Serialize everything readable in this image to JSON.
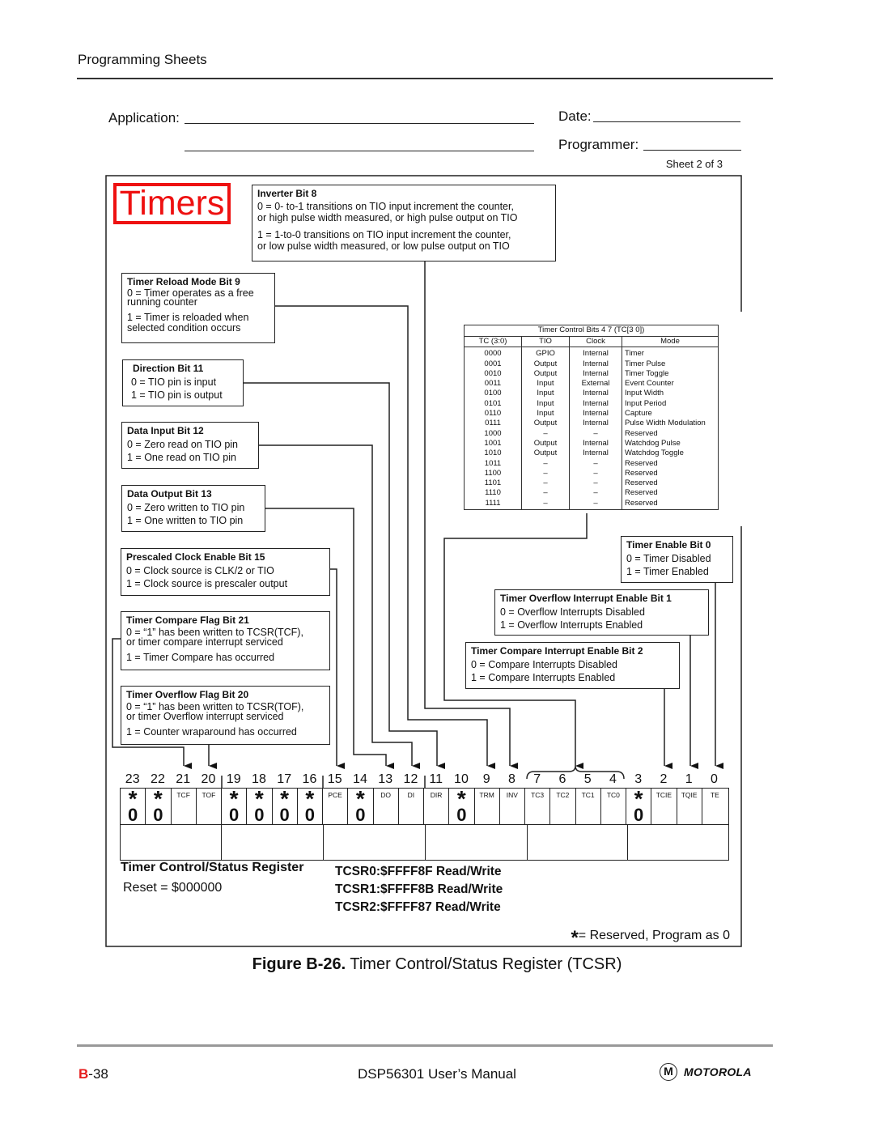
{
  "header": {
    "section": "Programming Sheets"
  },
  "form": {
    "application_label": "Application:",
    "application_value": "",
    "application_value_line2": "",
    "date_label": "Date:",
    "date_value": "",
    "programmer_label": "Programmer:",
    "programmer_value": "",
    "sheet": "Sheet 2 of 3"
  },
  "diagram": {
    "badge": "Timers",
    "boxes": {
      "inverter": {
        "title": "Inverter Bit 8",
        "lines": [
          "0  = 0- to-1 transitions on TIO input increment the counter,",
          "or high pulse width measured, or high pulse output on TIO",
          "1 = 1-to-0 transitions on TIO input increment the counter,",
          "or low pulse width measured, or low pulse output on TIO"
        ]
      },
      "reload": {
        "title": "Timer Reload Mode Bit 9",
        "lines": [
          "0 = Timer operates as a free",
          "running counter",
          "1 = Timer is reloaded when",
          "selected condition occurs"
        ]
      },
      "direction": {
        "title": "Direction Bit 11",
        "lines": [
          "0 = TIO pin is input",
          "1 = TIO pin is output"
        ]
      },
      "data_input": {
        "title": "Data Input Bit 12",
        "lines": [
          "0 = Zero read on TIO pin",
          "1 = One read on TIO pin"
        ]
      },
      "data_output": {
        "title": "Data Output Bit 13",
        "lines": [
          "0 = Zero written to TIO pin",
          "1 = One written to TIO pin"
        ]
      },
      "prescaled": {
        "title": "Prescaled Clock Enable Bit 15",
        "lines": [
          "0 = Clock source is CLK/2 or TIO",
          "1 = Clock source is prescaler output"
        ]
      },
      "compare_flag": {
        "title": "Timer Compare Flag Bit 21",
        "lines": [
          "0 = “1” has been written to TCSR(TCF),",
          "or timer compare interrupt serviced",
          "1 = Timer Compare has occurred"
        ]
      },
      "overflow_flag": {
        "title": "Timer Overflow Flag Bit 20",
        "lines": [
          "0 = “1” has been written to TCSR(TOF),",
          "or timer Overflow interrupt serviced",
          "1 = Counter wraparound has occurred"
        ]
      },
      "enable": {
        "title": "Timer Enable Bit 0",
        "lines": [
          "0 = Timer Disabled",
          "1 = Timer Enabled"
        ]
      },
      "overflow_irq": {
        "title": "Timer Overflow Interrupt Enable Bit 1",
        "lines": [
          "0 = Overflow Interrupts Disabled",
          "1 = Overflow Interrupts Enabled"
        ]
      },
      "compare_irq": {
        "title": "Timer Compare Interrupt Enable Bit 2",
        "lines": [
          "0 = Compare Interrupts Disabled",
          "1 = Compare Interrupts Enabled"
        ]
      }
    },
    "tc_table": {
      "caption": "Timer Control Bits 4 7 (TC[3 0])",
      "headers": [
        "TC (3:0)",
        "TIO",
        "Clock",
        "Mode"
      ],
      "rows": [
        [
          "0000",
          "GPIO",
          "Internal",
          "Timer"
        ],
        [
          "0001",
          "Output",
          "Internal",
          "Timer Pulse"
        ],
        [
          "0010",
          "Output",
          "Internal",
          "Timer Toggle"
        ],
        [
          "0011",
          "Input",
          "External",
          "Event Counter"
        ],
        [
          "0100",
          "Input",
          "Internal",
          "Input Width"
        ],
        [
          "0101",
          "Input",
          "Internal",
          "Input Period"
        ],
        [
          "0110",
          "Input",
          "Internal",
          "Capture"
        ],
        [
          "0111",
          "Output",
          "Internal",
          "Pulse Width Modulation"
        ],
        [
          "1000",
          "–",
          "–",
          "Reserved"
        ],
        [
          "1001",
          "Output",
          "Internal",
          "Watchdog Pulse"
        ],
        [
          "1010",
          "Output",
          "Internal",
          "Watchdog Toggle"
        ],
        [
          "1011",
          "–",
          "–",
          "Reserved"
        ],
        [
          "1100",
          "–",
          "–",
          "Reserved"
        ],
        [
          "1101",
          "–",
          "–",
          "Reserved"
        ],
        [
          "1110",
          "–",
          "–",
          "Reserved"
        ],
        [
          "1111",
          "–",
          "–",
          "Reserved"
        ]
      ]
    },
    "register": {
      "bits": [
        {
          "n": "23",
          "name": "",
          "reserved": true
        },
        {
          "n": "22",
          "name": "",
          "reserved": true
        },
        {
          "n": "21",
          "name": "TCF",
          "reserved": false
        },
        {
          "n": "20",
          "name": "TOF",
          "reserved": false
        },
        {
          "n": "19",
          "name": "",
          "reserved": true
        },
        {
          "n": "18",
          "name": "",
          "reserved": true
        },
        {
          "n": "17",
          "name": "",
          "reserved": true
        },
        {
          "n": "16",
          "name": "",
          "reserved": true
        },
        {
          "n": "15",
          "name": "PCE",
          "reserved": false
        },
        {
          "n": "14",
          "name": "",
          "reserved": true
        },
        {
          "n": "13",
          "name": "DO",
          "reserved": false
        },
        {
          "n": "12",
          "name": "DI",
          "reserved": false
        },
        {
          "n": "11",
          "name": "DIR",
          "reserved": false
        },
        {
          "n": "10",
          "name": "",
          "reserved": true
        },
        {
          "n": "9",
          "name": "TRM",
          "reserved": false
        },
        {
          "n": "8",
          "name": "INV",
          "reserved": false
        },
        {
          "n": "7",
          "name": "TC3",
          "reserved": false
        },
        {
          "n": "6",
          "name": "TC2",
          "reserved": false
        },
        {
          "n": "5",
          "name": "TC1",
          "reserved": false
        },
        {
          "n": "4",
          "name": "TC0",
          "reserved": false
        },
        {
          "n": "3",
          "name": "",
          "reserved": true
        },
        {
          "n": "2",
          "name": "TCIE",
          "reserved": false
        },
        {
          "n": "1",
          "name": "TQIE",
          "reserved": false
        },
        {
          "n": "0",
          "name": "TE",
          "reserved": false
        }
      ],
      "reserved_star": "*",
      "reserved_value": "0",
      "title": "Timer Control/Status Register",
      "reset": "Reset = $000000",
      "addresses": [
        "TCSR0:$FFFF8F Read/Write",
        "TCSR1:$FFFF8B Read/Write",
        "TCSR2:$FFFF87 Read/Write"
      ],
      "legend_star": "*",
      "legend_text": "= Reserved, Program as 0"
    },
    "caption_bold": "Figure B-26.",
    "caption_text": " Timer Control/Status Register (TCSR)"
  },
  "footer": {
    "page_prefix": "B",
    "page_suffix": "-38",
    "manual": "DSP56301 User’s Manual",
    "brand_mark": "M",
    "brand": "MOTOROLA"
  },
  "colors": {
    "accent_red": "#ee1111",
    "page_prefix_red": "#e61c1c"
  }
}
